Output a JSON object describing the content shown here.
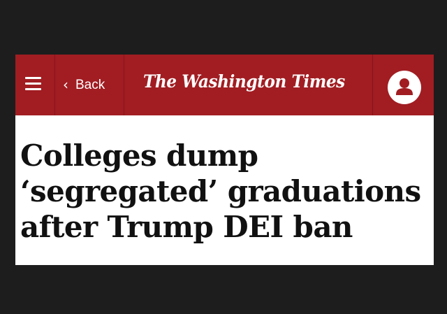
{
  "header": {
    "back_label": "Back",
    "back_chevron": "‹",
    "logo": "The Washington Times",
    "menu_icon": "hamburger-menu-icon",
    "profile_icon": "user-profile-icon",
    "brand_color": "#a11d22"
  },
  "article": {
    "headline_lines": [
      "Colleges dump",
      "‘segregated’ graduations",
      "after Trump DEI ban"
    ]
  }
}
